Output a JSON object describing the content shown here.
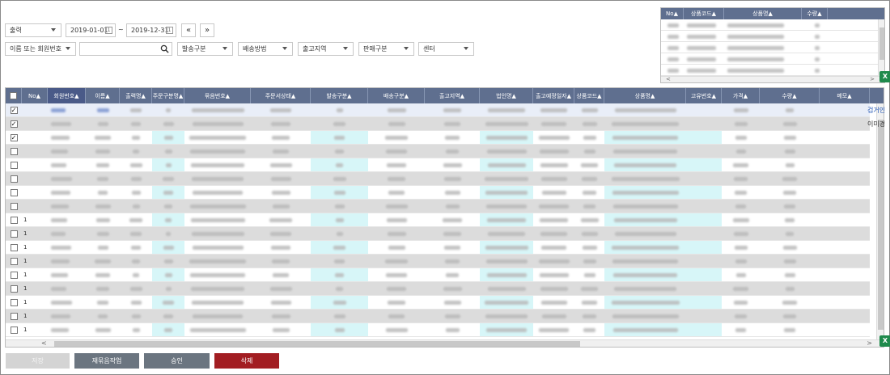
{
  "filters": {
    "type_select": "출력",
    "date_from": "2019-01-01",
    "date_sep": "~",
    "date_to": "2019-12-31",
    "date_icon": "calendar-icon",
    "prev_label": "«",
    "next_label": "»",
    "member_select": "이름 또는 회원번호",
    "search_value": "",
    "ship_type": "발송구분",
    "delivery_method": "배송방법",
    "region": "출고지역",
    "sale_type": "판매구분",
    "center": "센터"
  },
  "mini_table": {
    "headers": [
      "No▲",
      "상품코드▲",
      "상품명▲",
      "수량▲"
    ]
  },
  "main_table": {
    "headers": [
      "No▲",
      "회원번호▲",
      "이름▲",
      "출력명▲",
      "주문구분명▲",
      "묶음번호▲",
      "주문서상태▲",
      "발송구분▲",
      "배송구분▲",
      "출고지역▲",
      "법인명▲",
      "출고예정일자▲",
      "상품코드▲",
      "상품명▲",
      "고유번호▲",
      "가격▲",
      "수량▲",
      "메모▲"
    ],
    "checked_rows": [
      true,
      true,
      true,
      false,
      false,
      false,
      false,
      false,
      false,
      false,
      false,
      false,
      false,
      false,
      false,
      false,
      false
    ],
    "row_numbers": [
      "",
      "",
      "",
      "",
      "",
      "",
      "",
      "",
      "1",
      "1",
      "1",
      "1",
      "1",
      "1",
      "1",
      "1",
      "1"
    ],
    "side_links": [
      "검거인",
      "이미경"
    ]
  },
  "buttons": {
    "save": "저장",
    "rebundle": "재묶음작업",
    "approve": "승인",
    "delete": "삭제"
  },
  "icons": {
    "excel": "X"
  },
  "colors": {
    "header_bg": "#5f6f8f",
    "header_active": "#4a5a88",
    "row_alt": "#dcdcdc",
    "row_cyan": "#d7f6f8",
    "save_btn": "#d4d4d4",
    "gray_btn": "#6b7580",
    "delete_btn": "#a21d22",
    "link": "#1a4fb0"
  }
}
